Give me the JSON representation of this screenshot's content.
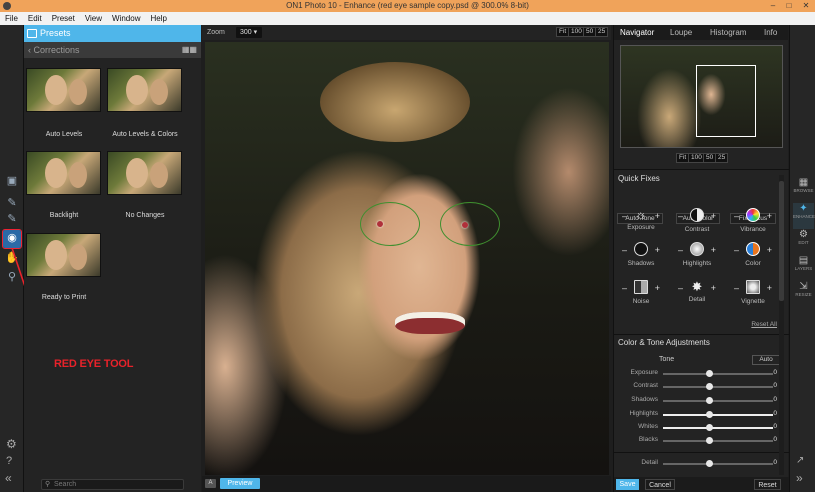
{
  "window": {
    "title": "ON1 Photo 10 - Enhance (red eye sample copy.psd @ 300.0% 8-bit)"
  },
  "menu": [
    "File",
    "Edit",
    "Preset",
    "View",
    "Window",
    "Help"
  ],
  "presets": {
    "header": "Presets",
    "category": "Corrections",
    "items": [
      "Auto Levels",
      "Auto Levels & Colors",
      "Backlight",
      "No Changes",
      "Ready to Print"
    ],
    "search_placeholder": "Search"
  },
  "annotation": "RED EYE TOOL",
  "canvas": {
    "zoom_label": "Zoom",
    "zoom_value": "300",
    "zoom_buttons": [
      "Fit",
      "100",
      "50",
      "25"
    ],
    "preview_label": "Preview"
  },
  "right_tabs": [
    "Navigator",
    "Loupe",
    "Histogram",
    "Info"
  ],
  "navigator": {
    "zoom_buttons": [
      "Fit",
      "100",
      "50",
      "25"
    ]
  },
  "quick_fixes": {
    "title": "Quick Fixes",
    "buttons": [
      "Auto Tone",
      "Auto Color",
      "Fix Focus"
    ],
    "items": [
      "Exposure",
      "Contrast",
      "Vibrance",
      "Shadows",
      "Highlights",
      "Color",
      "Noise",
      "Detail",
      "Vignette"
    ],
    "reset_all": "Reset All"
  },
  "color_tone": {
    "title": "Color & Tone Adjustments",
    "tone_label": "Tone",
    "auto_label": "Auto",
    "sliders": [
      {
        "name": "Exposure",
        "value": "0"
      },
      {
        "name": "Contrast",
        "value": "0"
      },
      {
        "name": "Shadows",
        "value": "0"
      },
      {
        "name": "Highlights",
        "value": "0"
      },
      {
        "name": "Whites",
        "value": "0"
      },
      {
        "name": "Blacks",
        "value": "0"
      },
      {
        "name": "Detail",
        "value": "0"
      }
    ]
  },
  "footer": {
    "save": "Save",
    "cancel": "Cancel",
    "reset": "Reset"
  },
  "left_tools": [
    {
      "icon": "crop-icon",
      "label": "crop"
    },
    {
      "icon": "retouch-brush-icon",
      "label": ""
    },
    {
      "icon": "brush-icon",
      "label": ""
    },
    {
      "icon": "red-eye-icon",
      "label": "eye"
    },
    {
      "icon": "hand-icon",
      "label": ""
    },
    {
      "icon": "zoom-icon",
      "label": "zoom"
    }
  ],
  "modules": [
    "BROWSE",
    "ENHANCE",
    "EDIT",
    "LAYERS",
    "RESIZE"
  ],
  "colors": {
    "accent": "#4fb6ea",
    "annotation": "#e8222a",
    "circle": "#3f8f2f",
    "titlebar": "#f0a35a"
  }
}
